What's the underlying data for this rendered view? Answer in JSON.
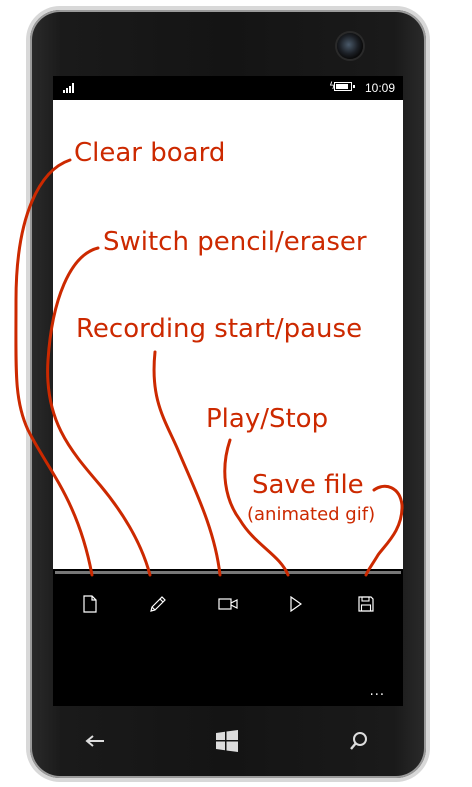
{
  "status_bar": {
    "time": "10:09",
    "signal_icon": "signal-bars-icon",
    "battery_icon": "battery-charging-icon"
  },
  "app_bar": {
    "buttons": [
      {
        "name": "new-document-button",
        "icon": "document-icon"
      },
      {
        "name": "pencil-eraser-button",
        "icon": "pencil-icon"
      },
      {
        "name": "record-button",
        "icon": "video-camera-icon"
      },
      {
        "name": "play-button",
        "icon": "play-icon"
      },
      {
        "name": "save-button",
        "icon": "floppy-disk-icon"
      }
    ],
    "more": "..."
  },
  "nav_bar": {
    "back_icon": "back-arrow-icon",
    "start_icon": "windows-logo-icon",
    "search_icon": "search-icon"
  },
  "annotations": {
    "clear_board": "Clear board",
    "switch_pencil": "Switch pencil/eraser",
    "recording": "Recording start/pause",
    "play_stop": "Play/Stop",
    "save_file": "Save file",
    "save_file_sub": "(animated gif)"
  },
  "colors": {
    "annotation": "#cc2900",
    "canvas": "#ffffff",
    "screen": "#000000"
  }
}
